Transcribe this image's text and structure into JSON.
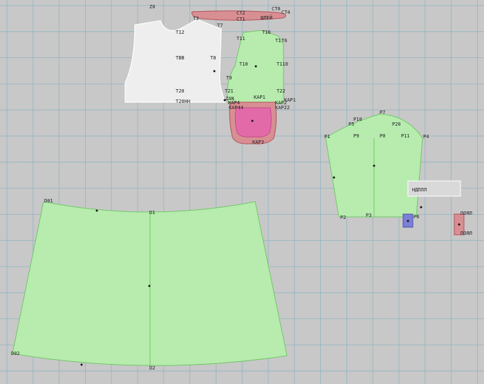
{
  "colors": {
    "background": "#c8c8c8",
    "grid": "#8fb4c2",
    "green_fill": "#b7ecae",
    "green_stroke": "#6fc866",
    "white_fill": "#eeeeee",
    "red_fill": "#d88f93",
    "red_stroke": "#b0505a",
    "pink_fill": "#e36aa8",
    "blue_fill": "#7b7fd8"
  },
  "labels": {
    "top_marker": "Z0",
    "collar": {
      "ct2": "CT2",
      "ct0": "CT0",
      "ct1": "CT1",
      "ct4": "CT4",
      "shot": "ШЛЕЙ"
    },
    "front": {
      "t12": "T12",
      "t3": "T3",
      "t7": "T7",
      "t8": "T8",
      "tbb": "TBB",
      "t20": "T20",
      "t20hh": "T20HH",
      "t21": "T21"
    },
    "side": {
      "t11": "T11",
      "t16": "T16",
      "t10": "T10",
      "t110": "T110",
      "t9": "T9",
      "t22": "T22",
      "t1": "T1",
      "t6": "T6"
    },
    "pocket": {
      "kap1": "KAP1",
      "kap2": "KAP2",
      "kap4": "KAP4",
      "kap44": "KAP44",
      "kap22": "KAP22",
      "kap3": "KAP3",
      "kap3b": "KAP3",
      "kap1b": "KAP1",
      "zan": "ZAN"
    },
    "sleeve": {
      "p7": "P7",
      "p10": "P10",
      "p20": "P20",
      "p5": "P5",
      "p1": "P1",
      "p9": "P9",
      "p0": "P0",
      "p11": "P11",
      "p4": "P4",
      "p2": "P2",
      "p3": "P3",
      "p6": "P6"
    },
    "label_box": "НДПЛЛ",
    "right_piece": {
      "top": "ПОЯЛ",
      "bottom": "ПОЯЛ"
    },
    "skirt": {
      "d01": "D01",
      "d1": "D1",
      "d02": "D02",
      "d2": "D2"
    }
  }
}
